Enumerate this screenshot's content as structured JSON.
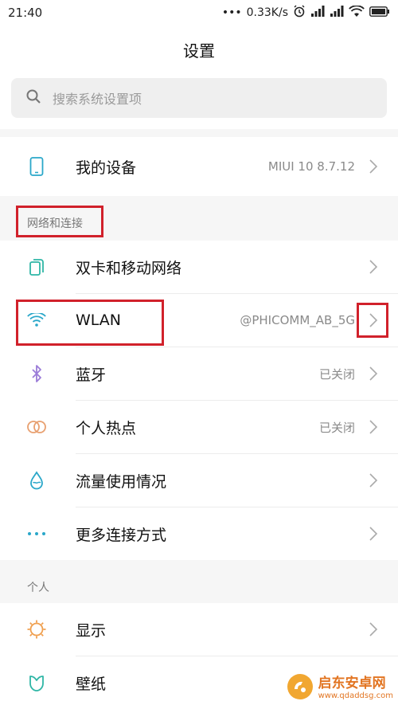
{
  "status_bar": {
    "time": "21:40",
    "dots": "•••",
    "speed": "0.33K/s"
  },
  "header": {
    "title": "设置"
  },
  "search": {
    "placeholder": "搜索系统设置项"
  },
  "device": {
    "label": "我的设备",
    "value": "MIUI 10 8.7.12"
  },
  "sections": {
    "network": "网络和连接",
    "personal": "个人"
  },
  "network_items": [
    {
      "label": "双卡和移动网络",
      "value": ""
    },
    {
      "label": "WLAN",
      "value": "@PHICOMM_AB_5G"
    },
    {
      "label": "蓝牙",
      "value": "已关闭"
    },
    {
      "label": "个人热点",
      "value": "已关闭"
    },
    {
      "label": "流量使用情况",
      "value": ""
    },
    {
      "label": "更多连接方式",
      "value": ""
    }
  ],
  "personal_items": [
    {
      "label": "显示"
    },
    {
      "label": "壁纸"
    }
  ],
  "watermark": {
    "site": "启东安卓网",
    "url": "www.qdaddsg.com"
  },
  "colors": {
    "accent": "#2aa7c9",
    "highlight": "#d1212b",
    "bluetooth": "#9b7cd8",
    "hotspot": "#e8a070",
    "display": "#f0a050",
    "wallpaper": "#2fb6a6"
  }
}
